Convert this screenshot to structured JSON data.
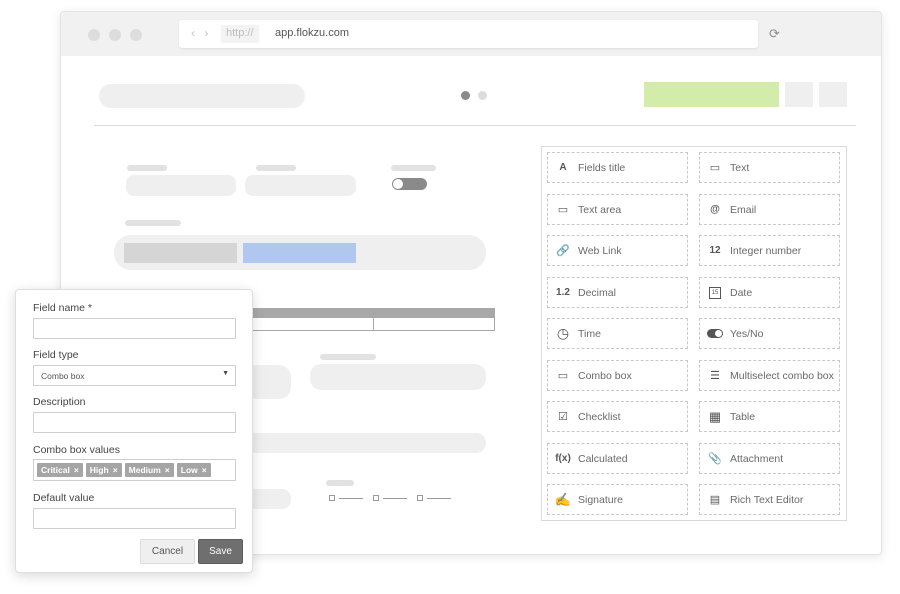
{
  "browser": {
    "protocol": "http://",
    "url": "app.flokzu.com",
    "nav_arrows": "‹ ›",
    "reload_icon": "⟳"
  },
  "palette": {
    "items": [
      {
        "icon": "A",
        "label": "Fields title",
        "name": "fields-title"
      },
      {
        "icon": "▭",
        "label": "Text",
        "name": "text"
      },
      {
        "icon": "▭",
        "label": "Text area",
        "name": "text-area"
      },
      {
        "icon": "@",
        "label": "Email",
        "name": "email"
      },
      {
        "icon": "🔗",
        "label": "Web Link",
        "name": "web-link"
      },
      {
        "icon": "12",
        "label": "Integer number",
        "name": "integer-number"
      },
      {
        "icon": "1.2",
        "label": "Decimal",
        "name": "decimal"
      },
      {
        "icon": "15",
        "label": "Date",
        "name": "date"
      },
      {
        "icon": "◷",
        "label": "Time",
        "name": "time"
      },
      {
        "icon": "●",
        "label": "Yes/No",
        "name": "yes-no"
      },
      {
        "icon": "▭",
        "label": "Combo box",
        "name": "combo-box"
      },
      {
        "icon": "☰",
        "label": "Multiselect combo box",
        "name": "multiselect-combo-box"
      },
      {
        "icon": "☑",
        "label": "Checklist",
        "name": "checklist"
      },
      {
        "icon": "▦",
        "label": "Table",
        "name": "table"
      },
      {
        "icon": "f(x)",
        "label": "Calculated",
        "name": "calculated"
      },
      {
        "icon": "📎",
        "label": "Attachment",
        "name": "attachment"
      },
      {
        "icon": "✍",
        "label": "Signature",
        "name": "signature"
      },
      {
        "icon": "▤",
        "label": "Rich Text Editor",
        "name": "rich-text-editor"
      }
    ]
  },
  "dialog": {
    "field_name_label": "Field name *",
    "field_name_value": "",
    "field_type_label": "Field type",
    "field_type_value": "Combo box",
    "description_label": "Description",
    "description_value": "",
    "combo_values_label": "Combo box values",
    "combo_values": [
      "Critical",
      "High",
      "Medium",
      "Low"
    ],
    "tag_remove": "×",
    "default_value_label": "Default value",
    "default_value": "",
    "cancel_label": "Cancel",
    "save_label": "Save"
  },
  "colors": {
    "accent_green": "#d4ecaa",
    "accent_blue": "#b0c8f0",
    "save_button": "#6f6f6f"
  }
}
